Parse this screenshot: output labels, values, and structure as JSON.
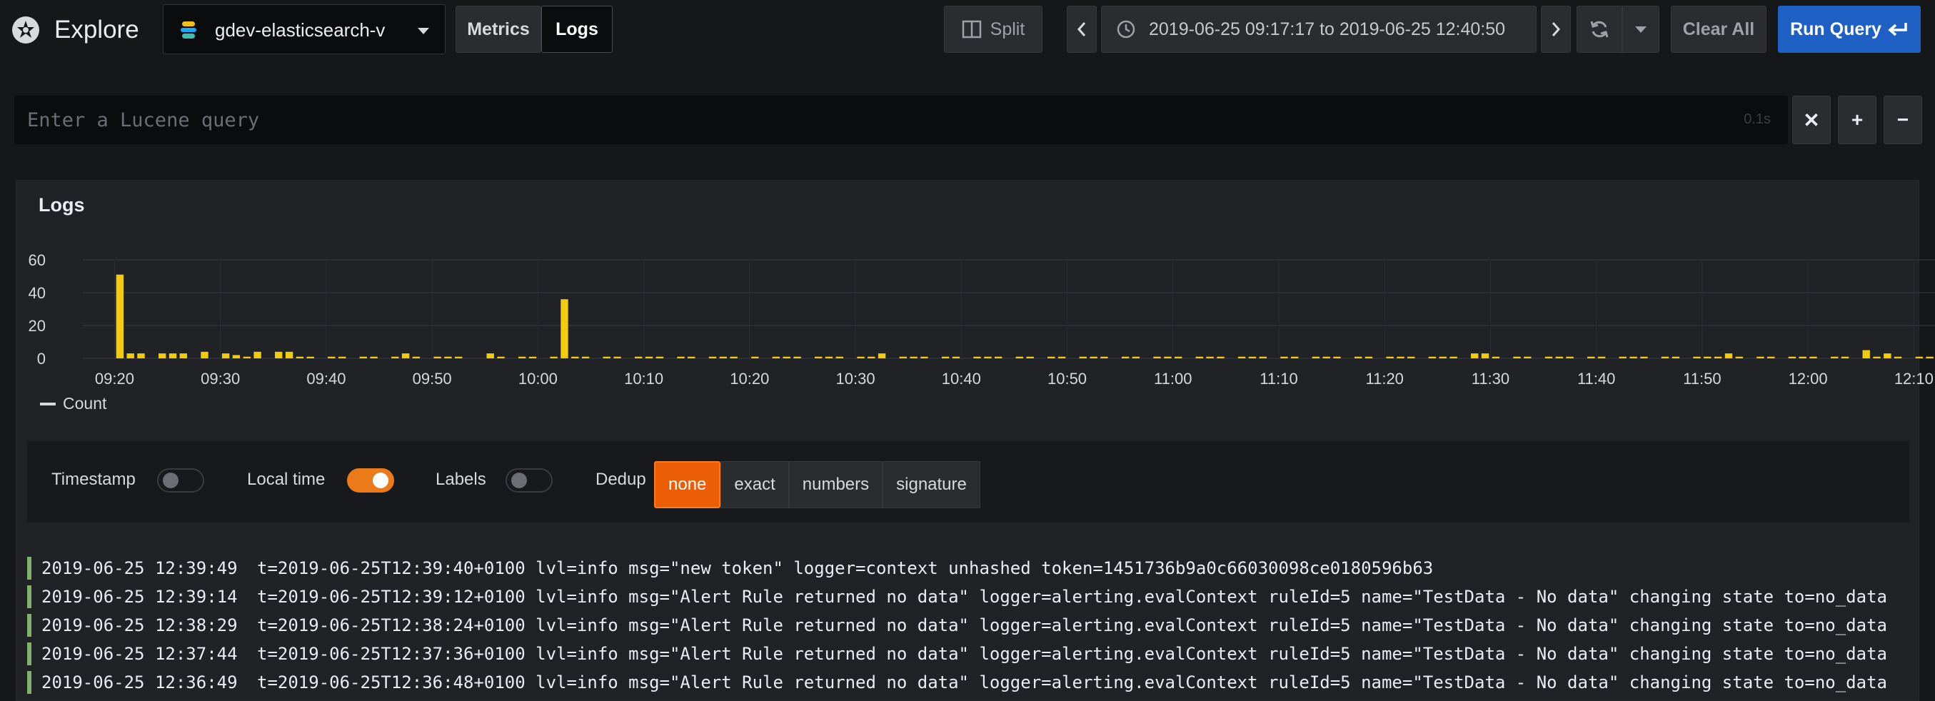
{
  "app": {
    "title": "Explore",
    "logo_icon": "grafana-logo-icon"
  },
  "datasource": {
    "name": "gdev-elasticsearch-v",
    "icon": "elasticsearch-icon"
  },
  "mode_tabs": [
    {
      "label": "Metrics",
      "active": false
    },
    {
      "label": "Logs",
      "active": true
    }
  ],
  "toolbar": {
    "split_label": "Split",
    "time_range": "2019-06-25 09:17:17 to 2019-06-25 12:40:50",
    "clear_label": "Clear All",
    "run_label": "Run Query"
  },
  "query": {
    "placeholder": "Enter a Lucene query",
    "value": "",
    "duration": "0.1s"
  },
  "logs_panel": {
    "title": "Logs"
  },
  "chart_data": {
    "type": "bar",
    "series": [
      {
        "name": "Count",
        "color": "#f2cc0c"
      }
    ],
    "ylim": [
      0,
      60
    ],
    "y_ticks": [
      "0",
      "20",
      "40",
      "60"
    ],
    "x_ticks": [
      "09:20",
      "09:30",
      "09:40",
      "09:50",
      "10:00",
      "10:10",
      "10:20",
      "10:30",
      "10:40",
      "10:50",
      "11:00",
      "11:10",
      "11:20",
      "11:30",
      "11:40",
      "11:50",
      "12:00",
      "12:10"
    ],
    "x_start": "09:17",
    "x_end": "12:12",
    "bin_minutes": 1,
    "values": [
      0,
      0,
      0,
      51,
      3,
      3,
      0,
      3,
      3,
      3,
      0,
      4,
      0,
      3,
      2,
      1,
      4,
      0,
      4,
      4,
      1,
      1,
      0,
      1,
      1,
      0,
      1,
      1,
      0,
      1,
      3,
      1,
      0,
      1,
      1,
      1,
      0,
      0,
      3,
      1,
      0,
      1,
      1,
      0,
      1,
      36,
      1,
      1,
      0,
      1,
      1,
      0,
      1,
      1,
      1,
      0,
      1,
      1,
      0,
      1,
      1,
      1,
      0,
      1,
      0,
      1,
      1,
      1,
      0,
      1,
      1,
      1,
      0,
      1,
      1,
      3,
      0,
      1,
      1,
      1,
      0,
      1,
      1,
      0,
      1,
      1,
      1,
      0,
      1,
      1,
      0,
      1,
      1,
      0,
      1,
      1,
      1,
      0,
      1,
      1,
      0,
      1,
      1,
      1,
      0,
      1,
      1,
      1,
      0,
      1,
      1,
      1,
      0,
      1,
      1,
      0,
      1,
      1,
      1,
      0,
      1,
      1,
      0,
      1,
      1,
      1,
      0,
      1,
      1,
      1,
      0,
      3,
      3,
      1,
      0,
      1,
      1,
      0,
      1,
      1,
      1,
      0,
      1,
      1,
      0,
      1,
      1,
      1,
      0,
      1,
      1,
      0,
      1,
      1,
      1,
      3,
      1,
      0,
      1,
      1,
      0,
      1,
      1,
      1,
      0,
      1,
      1,
      0,
      5,
      1,
      3,
      1,
      0,
      1,
      1,
      0,
      1,
      1,
      1,
      0,
      1,
      1,
      0,
      1,
      1,
      1,
      2,
      1,
      0,
      1,
      1,
      1,
      0,
      1,
      1,
      1,
      0,
      1,
      1,
      0,
      1,
      1,
      1,
      0,
      1,
      1,
      0,
      1,
      1,
      1,
      0,
      1,
      1,
      0,
      1,
      1,
      0,
      1,
      1,
      1,
      0,
      1,
      1,
      0,
      1,
      1,
      0,
      0,
      0,
      0,
      0,
      0,
      0,
      0,
      0,
      0,
      0,
      0,
      0,
      0,
      0,
      0,
      0,
      0,
      0,
      0,
      0,
      0,
      0,
      0,
      0,
      0,
      0,
      0,
      0,
      0,
      0,
      0,
      0,
      0
    ]
  },
  "controls": {
    "timestamp": {
      "label": "Timestamp",
      "on": false
    },
    "local_time": {
      "label": "Local time",
      "on": true
    },
    "labels": {
      "label": "Labels",
      "on": false
    },
    "dedup": {
      "label": "Dedup",
      "options": [
        "none",
        "exact",
        "numbers",
        "signature"
      ],
      "selected": "none"
    }
  },
  "log_rows": [
    {
      "time": "2019-06-25 12:39:49",
      "message": "t=2019-06-25T12:39:40+0100 lvl=info msg=\"new token\" logger=context unhashed token=1451736b9a0c66030098ce0180596b63"
    },
    {
      "time": "2019-06-25 12:39:14",
      "message": "t=2019-06-25T12:39:12+0100 lvl=info msg=\"Alert Rule returned no data\" logger=alerting.evalContext ruleId=5 name=\"TestData - No data\" changing state to=no_data"
    },
    {
      "time": "2019-06-25 12:38:29",
      "message": "t=2019-06-25T12:38:24+0100 lvl=info msg=\"Alert Rule returned no data\" logger=alerting.evalContext ruleId=5 name=\"TestData - No data\" changing state to=no_data"
    },
    {
      "time": "2019-06-25 12:37:44",
      "message": "t=2019-06-25T12:37:36+0100 lvl=info msg=\"Alert Rule returned no data\" logger=alerting.evalContext ruleId=5 name=\"TestData - No data\" changing state to=no_data"
    },
    {
      "time": "2019-06-25 12:36:49",
      "message": "t=2019-06-25T12:36:48+0100 lvl=info msg=\"Alert Rule returned no data\" logger=alerting.evalContext ruleId=5 name=\"TestData - No data\" changing state to=no_data"
    }
  ],
  "colors": {
    "accent": "#1f60c4",
    "toggle_on": "#eb7b18",
    "dedup_active": "#eb5e05",
    "bar": "#f2cc0c",
    "log_level_info": "#7eb26d"
  }
}
